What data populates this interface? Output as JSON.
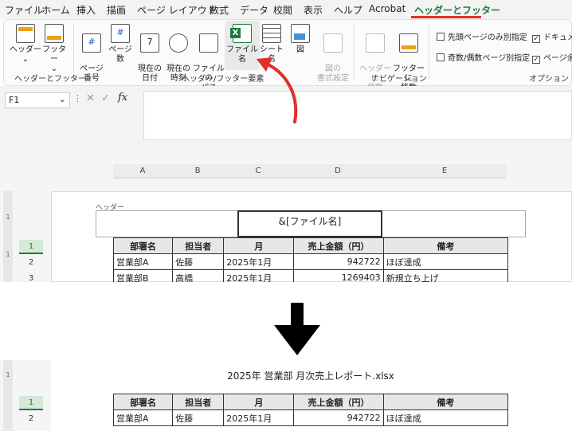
{
  "menu": {
    "tabs": [
      "ファイル",
      "ホーム",
      "挿入",
      "描画",
      "ページ レイアウト",
      "数式",
      "データ",
      "校閲",
      "表示",
      "ヘルプ",
      "Acrobat",
      "ヘッダーとフッター"
    ],
    "active_tab": "ヘッダーとフッター"
  },
  "ribbon": {
    "header_btn": "ヘッダー",
    "footer_btn": "フッター",
    "page_number": "ページ\n番号",
    "page_count": "ページ数",
    "current_date": "現在の\n日付",
    "current_time": "現在の\n時刻",
    "file_path": "ファイルの\nパス",
    "file_name": "ファイル名",
    "sheet_name": "シート名",
    "picture": "図",
    "format_picture": "図の\n書式設定",
    "goto_header": "ヘッダーに\n移動",
    "goto_footer": "フッターに\n移動",
    "group_hf": "ヘッダーとフッター",
    "group_elements": "ヘッダー/フッター要素",
    "group_nav": "ナビゲーション",
    "group_options": "オプション",
    "opt_first_page": "先頭ページのみ別指定",
    "opt_odd_even": "奇数/偶数ページ別指定",
    "opt_scale": "ドキュメン",
    "opt_align": "ページ余白"
  },
  "formula_bar": {
    "name_box": "F1",
    "fx": "fx"
  },
  "sheet": {
    "columns": [
      "A",
      "B",
      "C",
      "D",
      "E"
    ],
    "header_area_label": "ヘッダー",
    "header_code": "&[ファイル名]",
    "table_headers": [
      "部署名",
      "担当者",
      "月",
      "売上金額（円）",
      "備考"
    ],
    "rows": [
      [
        "営業部A",
        "佐藤",
        "2025年1月",
        "942722",
        "ほぼ達成"
      ],
      [
        "営業部B",
        "高橋",
        "2025年1月",
        "1269403",
        "新規立ち上げ"
      ]
    ],
    "row_numbers": [
      "1",
      "2",
      "3"
    ],
    "ruler_numbers": [
      "1",
      "1"
    ]
  },
  "result": {
    "header_text": "2025年 営業部 月次売上レポート.xlsx",
    "table_headers": [
      "部署名",
      "担当者",
      "月",
      "売上金額（円）",
      "備考"
    ],
    "row": [
      "営業部A",
      "佐藤",
      "2025年1月",
      "942722",
      "ほぼ達成"
    ],
    "row_numbers": [
      "1",
      "2"
    ],
    "ruler_number": "1"
  },
  "colors": {
    "accent": "#1e7a3c",
    "highlight": "#e0302a"
  }
}
